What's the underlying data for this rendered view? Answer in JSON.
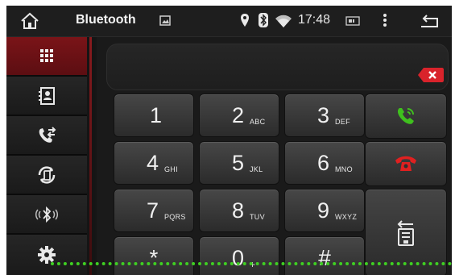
{
  "statusbar": {
    "title": "Bluetooth",
    "time": "17:48",
    "icons": [
      "home-icon",
      "image-icon",
      "location-icon",
      "bluetooth-icon",
      "wifi-icon",
      "battery-icon",
      "more-vert-icon",
      "back-icon"
    ]
  },
  "sidebar": {
    "items": [
      {
        "name": "dialpad",
        "icon": "dialpad-icon",
        "active": true
      },
      {
        "name": "contacts",
        "icon": "contacts-icon",
        "active": false
      },
      {
        "name": "call-log",
        "icon": "call-log-icon",
        "active": false
      },
      {
        "name": "sync",
        "icon": "phone-sync-icon",
        "active": false
      },
      {
        "name": "bluetooth-connect",
        "icon": "bluetooth-signal-icon",
        "active": false
      },
      {
        "name": "settings",
        "icon": "gear-icon",
        "active": false
      }
    ]
  },
  "dialer": {
    "number": "",
    "keys": [
      {
        "digit": "1",
        "letters": ""
      },
      {
        "digit": "2",
        "letters": "ABC"
      },
      {
        "digit": "3",
        "letters": "DEF"
      },
      {
        "digit": "4",
        "letters": "GHI"
      },
      {
        "digit": "5",
        "letters": "JKL"
      },
      {
        "digit": "6",
        "letters": "MNO"
      },
      {
        "digit": "7",
        "letters": "PQRS"
      },
      {
        "digit": "8",
        "letters": "TUV"
      },
      {
        "digit": "9",
        "letters": "WXYZ"
      },
      {
        "digit": "*",
        "letters": ""
      },
      {
        "digit": "0",
        "letters": "+"
      },
      {
        "digit": "#",
        "letters": ""
      }
    ]
  },
  "colors": {
    "accent_red": "#7a1418",
    "call_green": "#3fc01e",
    "end_red": "#e02020",
    "dotted_line": "#3fcf22"
  }
}
